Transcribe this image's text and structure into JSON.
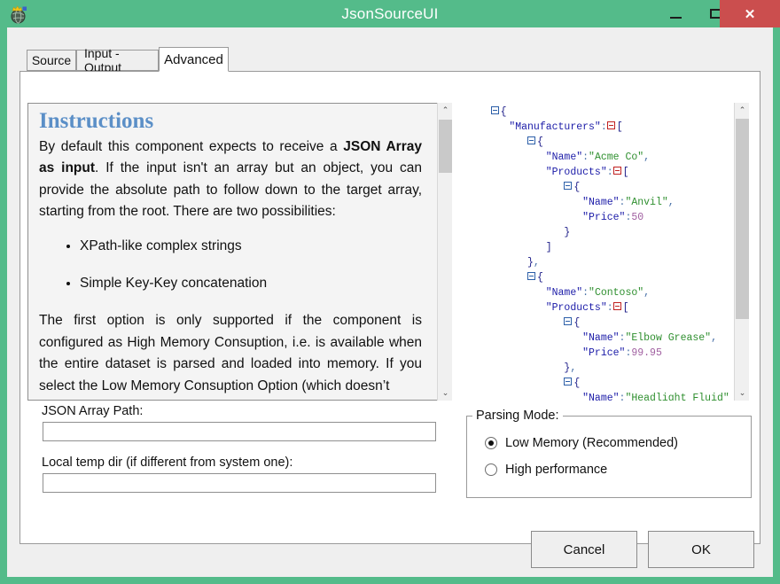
{
  "window": {
    "title": "JsonSourceUI",
    "icon": "globe-crown-icon",
    "titlebar_color": "#54bb8a",
    "close_color": "#cb4e4e",
    "minimize_label": "—",
    "maximize_label": "□",
    "close_label": "✕"
  },
  "tabs": [
    {
      "label": "Source",
      "selected": false
    },
    {
      "label": "Input - Output",
      "selected": false
    },
    {
      "label": "Advanced",
      "selected": true
    }
  ],
  "instructions": {
    "title": "Instructions",
    "title_color": "#5b8fc7",
    "paragraph_1_a": "By default this component expects to receive a ",
    "paragraph_1_bold": "JSON Array as input",
    "paragraph_1_b": ". If the input isn't an array but an object, you can provide the absolute path to follow down to the target array, starting from the root. There are two possibilities:",
    "bullets": [
      "XPath-like complex strings",
      "Simple Key-Key concatenation"
    ],
    "paragraph_2": "The first option is only supported if the component is configured as High Memory Consuption, i.e. is available when the entire dataset is parsed and loaded into memory. If you select the Low Memory Consuption Option (which doesn’t"
  },
  "json_preview": {
    "lines": [
      {
        "indent": 0,
        "expander": "blue",
        "parts": [
          {
            "t": "{",
            "c": "jbrack"
          }
        ]
      },
      {
        "indent": 1,
        "expander": null,
        "parts": [
          {
            "t": "\"Manufacturers\"",
            "c": "jkey"
          },
          {
            "t": ":",
            "c": "jpunc"
          }
        ],
        "expander_after": "red",
        "after": [
          {
            "t": "[",
            "c": "jbrack"
          }
        ]
      },
      {
        "indent": 2,
        "expander": "blue",
        "parts": [
          {
            "t": "{",
            "c": "jbrack"
          }
        ]
      },
      {
        "indent": 3,
        "expander": null,
        "parts": [
          {
            "t": "\"Name\"",
            "c": "jkey"
          },
          {
            "t": ":",
            "c": "jpunc"
          },
          {
            "t": "\"Acme Co\"",
            "c": "jstr"
          },
          {
            "t": ",",
            "c": "jpunc"
          }
        ]
      },
      {
        "indent": 3,
        "expander": null,
        "parts": [
          {
            "t": "\"Products\"",
            "c": "jkey"
          },
          {
            "t": ":",
            "c": "jpunc"
          }
        ],
        "expander_after": "red",
        "after": [
          {
            "t": "[",
            "c": "jbrack"
          }
        ]
      },
      {
        "indent": 4,
        "expander": "blue",
        "parts": [
          {
            "t": "{",
            "c": "jbrack"
          }
        ]
      },
      {
        "indent": 5,
        "expander": null,
        "parts": [
          {
            "t": "\"Name\"",
            "c": "jkey"
          },
          {
            "t": ":",
            "c": "jpunc"
          },
          {
            "t": "\"Anvil\"",
            "c": "jstr"
          },
          {
            "t": ",",
            "c": "jpunc"
          }
        ]
      },
      {
        "indent": 5,
        "expander": null,
        "parts": [
          {
            "t": "\"Price\"",
            "c": "jkey"
          },
          {
            "t": ":",
            "c": "jpunc"
          },
          {
            "t": "50",
            "c": "jnum"
          }
        ]
      },
      {
        "indent": 4,
        "expander": null,
        "parts": [
          {
            "t": "}",
            "c": "jbrack"
          }
        ]
      },
      {
        "indent": 3,
        "expander": null,
        "parts": [
          {
            "t": "]",
            "c": "jbrack"
          }
        ]
      },
      {
        "indent": 2,
        "expander": null,
        "parts": [
          {
            "t": "}",
            "c": "jbrack"
          },
          {
            "t": ",",
            "c": "jpunc"
          }
        ]
      },
      {
        "indent": 2,
        "expander": "blue",
        "parts": [
          {
            "t": "{",
            "c": "jbrack"
          }
        ]
      },
      {
        "indent": 3,
        "expander": null,
        "parts": [
          {
            "t": "\"Name\"",
            "c": "jkey"
          },
          {
            "t": ":",
            "c": "jpunc"
          },
          {
            "t": "\"Contoso\"",
            "c": "jstr"
          },
          {
            "t": ",",
            "c": "jpunc"
          }
        ]
      },
      {
        "indent": 3,
        "expander": null,
        "parts": [
          {
            "t": "\"Products\"",
            "c": "jkey"
          },
          {
            "t": ":",
            "c": "jpunc"
          }
        ],
        "expander_after": "red",
        "after": [
          {
            "t": "[",
            "c": "jbrack"
          }
        ]
      },
      {
        "indent": 4,
        "expander": "blue",
        "parts": [
          {
            "t": "{",
            "c": "jbrack"
          }
        ]
      },
      {
        "indent": 5,
        "expander": null,
        "parts": [
          {
            "t": "\"Name\"",
            "c": "jkey"
          },
          {
            "t": ":",
            "c": "jpunc"
          },
          {
            "t": "\"Elbow Grease\"",
            "c": "jstr"
          },
          {
            "t": ",",
            "c": "jpunc"
          }
        ]
      },
      {
        "indent": 5,
        "expander": null,
        "parts": [
          {
            "t": "\"Price\"",
            "c": "jkey"
          },
          {
            "t": ":",
            "c": "jpunc"
          },
          {
            "t": "99.95",
            "c": "jnum"
          }
        ]
      },
      {
        "indent": 4,
        "expander": null,
        "parts": [
          {
            "t": "}",
            "c": "jbrack"
          },
          {
            "t": ",",
            "c": "jpunc"
          }
        ]
      },
      {
        "indent": 4,
        "expander": "blue",
        "parts": [
          {
            "t": "{",
            "c": "jbrack"
          }
        ]
      },
      {
        "indent": 5,
        "expander": null,
        "parts": [
          {
            "t": "\"Name\"",
            "c": "jkey"
          },
          {
            "t": ":",
            "c": "jpunc"
          },
          {
            "t": "\"Headlight Fluid\"",
            "c": "jstr"
          }
        ]
      }
    ]
  },
  "form": {
    "json_array_path": {
      "label": "JSON Array Path:",
      "value": "",
      "placeholder": ""
    },
    "local_temp_dir": {
      "label": "Local temp dir (if different from system one):",
      "value": "",
      "placeholder": ""
    }
  },
  "parsing_mode": {
    "title": "Parsing Mode:",
    "options": [
      {
        "label": "Low Memory (Recommended)",
        "selected": true
      },
      {
        "label": "High performance",
        "selected": false
      }
    ]
  },
  "buttons": {
    "cancel": "Cancel",
    "ok": "OK"
  },
  "scrollbars": {
    "up_arrow": "⌃",
    "down_arrow": "⌄"
  }
}
